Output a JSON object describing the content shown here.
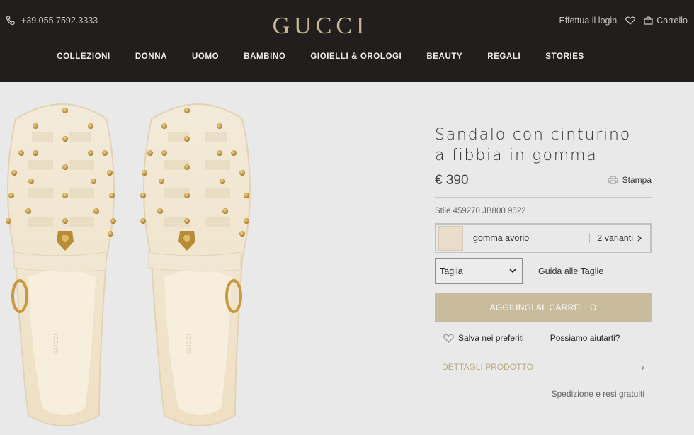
{
  "header": {
    "phone": "+39.055.7592.3333",
    "logo": "GUCCI",
    "login": "Effettua il login",
    "cart": "Carrello",
    "nav": [
      "COLLEZIONI",
      "DONNA",
      "UOMO",
      "BAMBINO",
      "GIOIELLI & OROLOGI",
      "BEAUTY",
      "REGALI",
      "STORIES"
    ]
  },
  "product": {
    "title_line1": "Sandalo con cinturino",
    "title_line2": "a fibbia in gomma",
    "price": "€ 390",
    "print_label": "Stampa",
    "style": "Stile 459270 JB800 9522",
    "variant_name": "gomma avorio",
    "variant_count": "2 varianti",
    "size_label": "Taglia",
    "size_guide": "Guida alle Taglie",
    "add_to_cart": "AGGIUNGI AL CARRELLO",
    "save_favorites": "Salva nei preferiti",
    "help": "Possiamo aiutarti?",
    "details": "DETTAGLI PRODOTTO",
    "shipping": "Spedizione e resi gratuiti"
  },
  "icons": {
    "phone": "phone-icon",
    "heart": "heart-icon",
    "bag": "shopping-bag-icon",
    "printer": "printer-icon",
    "chevron": "chevron-right-icon",
    "dropdown": "chevron-down-icon"
  },
  "colors": {
    "header_bg": "#221e1d",
    "logo_gold": "#c9b88f",
    "button_gold": "#c8bc9c",
    "page_bg": "#e9e9e9",
    "swatch": "#e9dcc9"
  }
}
